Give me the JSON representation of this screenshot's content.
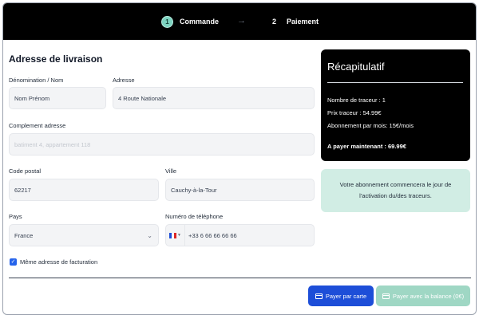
{
  "stepper": {
    "step1": {
      "number": "1",
      "label": "Commande"
    },
    "arrow": "→",
    "step2": {
      "number": "2",
      "label": "Paiement"
    }
  },
  "form": {
    "title": "Adresse de livraison",
    "denomination": {
      "label": "Dénomination / Nom",
      "value": "Nom Prénom"
    },
    "adresse": {
      "label": "Adresse",
      "value": "4 Route Nationale"
    },
    "complement": {
      "label": "Complement adresse",
      "placeholder": "batiment 4, appartement 118"
    },
    "code_postal": {
      "label": "Code postal",
      "value": "62217"
    },
    "ville": {
      "label": "Ville",
      "value": "Cauchy-à-la-Tour"
    },
    "pays": {
      "label": "Pays",
      "value": "France"
    },
    "telephone": {
      "label": "Numéro de téléphone",
      "value": "+33 6 66 66 66 66"
    },
    "same_billing": {
      "label": "Même adresse de facturation",
      "checked": true
    }
  },
  "actions": {
    "pay_card": "Payer par carte",
    "pay_balance": "Payer avec la balance (0€)"
  },
  "summary": {
    "title": "Récapitulatif",
    "rows": [
      "Nombre de traceur : 1",
      "Prix traceur : 54.99€",
      "Abonnement par mois: 15€/mois"
    ],
    "total": "A payer maintenant : 69.99€"
  },
  "note": "Votre abonnement commencera le jour de l'activation du/des traceurs.",
  "colors": {
    "header_bg": "#000000",
    "primary_button": "#1d4ed8",
    "balance_button": "#9fd7c4",
    "note_bg": "#d1ede4",
    "step_active": "#7dd3c0"
  }
}
